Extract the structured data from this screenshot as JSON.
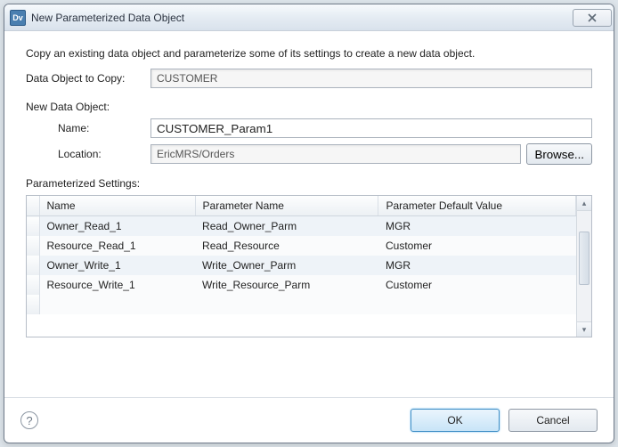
{
  "window": {
    "title": "New Parameterized Data Object",
    "app_icon_label": "Dv"
  },
  "description": "Copy an existing data object and parameterize some of its settings to create a new data object.",
  "labels": {
    "data_object_to_copy": "Data Object to Copy:",
    "new_data_object": "New Data Object:",
    "name": "Name:",
    "location": "Location:",
    "parameterized_settings": "Parameterized Settings:"
  },
  "fields": {
    "data_object_to_copy": "CUSTOMER",
    "name": "CUSTOMER_Param1",
    "location": "EricMRS/Orders"
  },
  "buttons": {
    "browse": "Browse...",
    "ok": "OK",
    "cancel": "Cancel"
  },
  "table": {
    "columns": {
      "name": "Name",
      "parameter_name": "Parameter Name",
      "parameter_default_value": "Parameter Default Value"
    },
    "rows": [
      {
        "name": "Owner_Read_1",
        "parameter_name": "Read_Owner_Parm",
        "parameter_default_value": "MGR"
      },
      {
        "name": "Resource_Read_1",
        "parameter_name": "Read_Resource",
        "parameter_default_value": "Customer"
      },
      {
        "name": "Owner_Write_1",
        "parameter_name": "Write_Owner_Parm",
        "parameter_default_value": "MGR"
      },
      {
        "name": "Resource_Write_1",
        "parameter_name": "Write_Resource_Parm",
        "parameter_default_value": "Customer"
      }
    ]
  }
}
